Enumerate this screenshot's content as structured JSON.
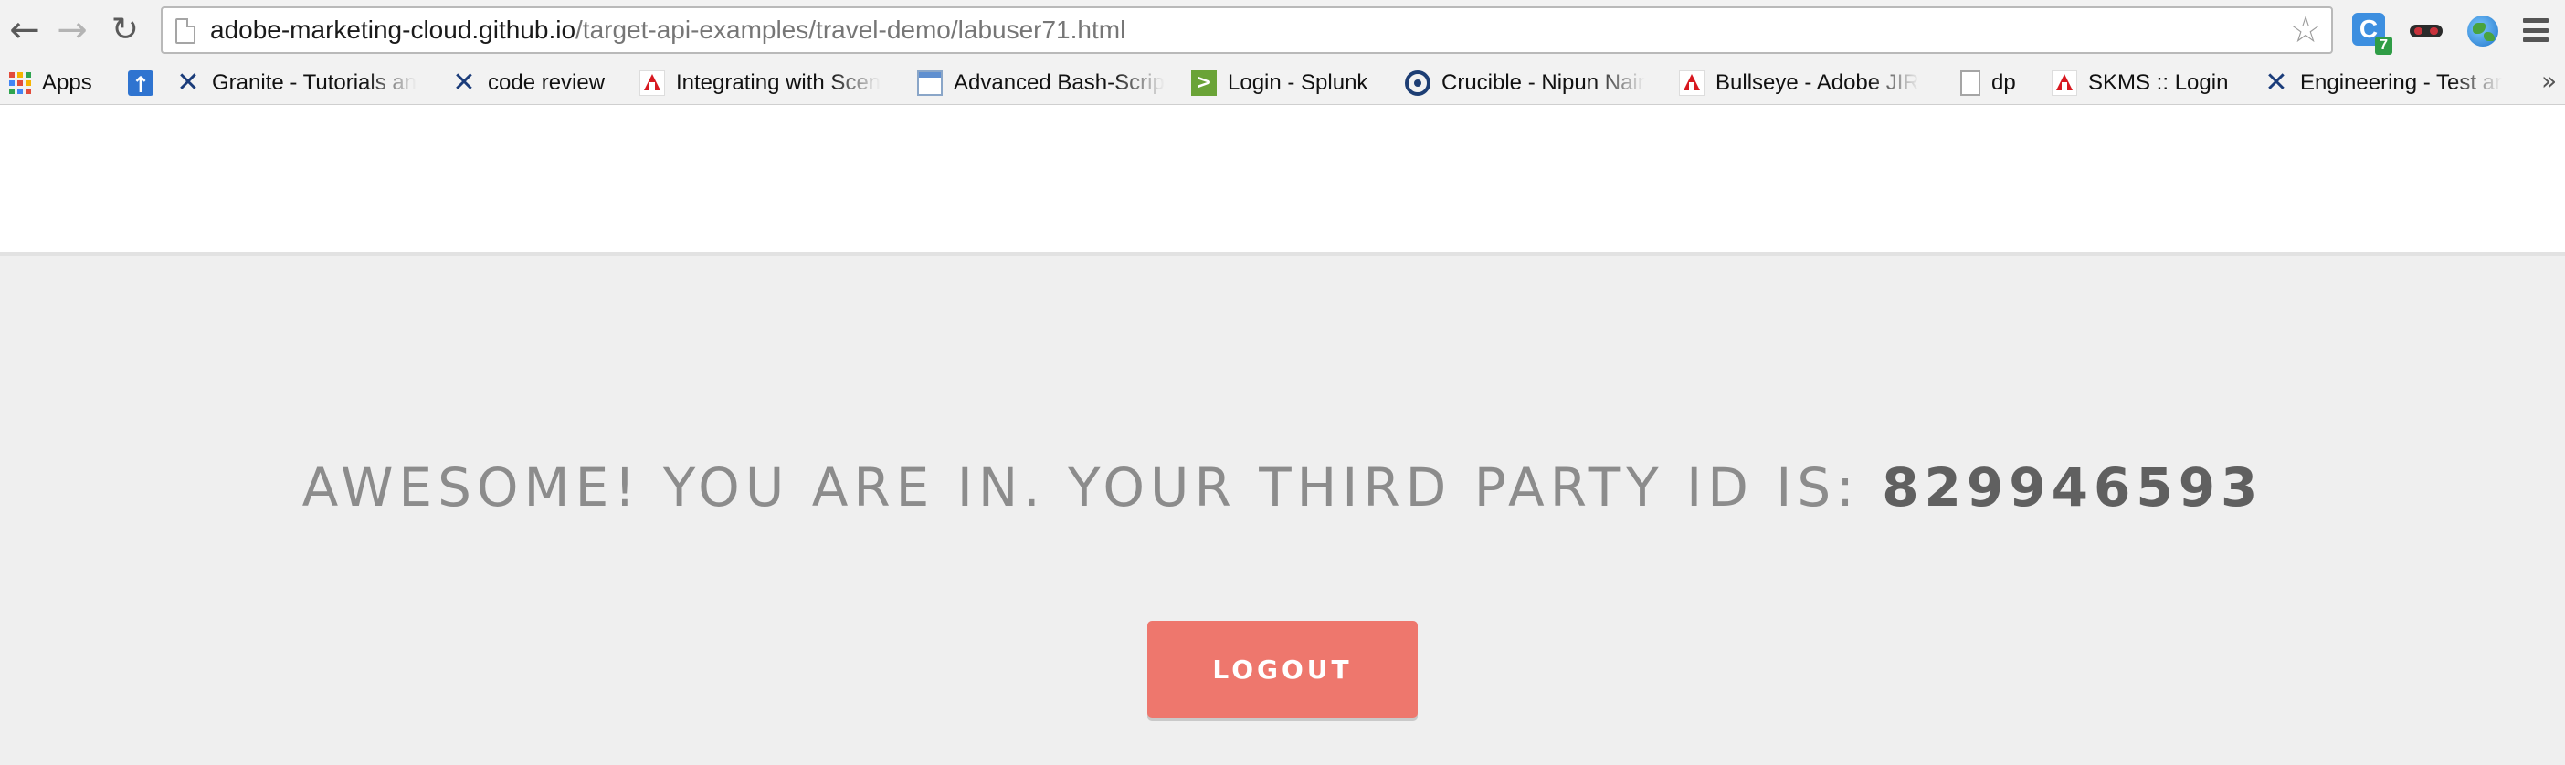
{
  "browser": {
    "url_host": "adobe-marketing-cloud.github.io",
    "url_path": "/target-api-examples/travel-demo/labuser71.html",
    "extensions": [
      {
        "name": "c-extension-icon",
        "badge": "7"
      },
      {
        "name": "mask-extension-icon"
      },
      {
        "name": "globe-extension-icon"
      }
    ]
  },
  "bookmarks": [
    {
      "label": "Apps",
      "icon": "apps-grid-icon"
    },
    {
      "label": "",
      "icon": "blue-upload-icon"
    },
    {
      "label": "Granite - Tutorials an",
      "icon": "x-logo-icon"
    },
    {
      "label": "code review",
      "icon": "x-logo-icon"
    },
    {
      "label": "Integrating with Scen",
      "icon": "adobe-icon"
    },
    {
      "label": "Advanced Bash-Scrip",
      "icon": "bash-page-icon"
    },
    {
      "label": "Login - Splunk",
      "icon": "splunk-icon"
    },
    {
      "label": "Crucible - Nipun Nair",
      "icon": "crucible-icon"
    },
    {
      "label": "Bullseye - Adobe JIR",
      "icon": "adobe-icon"
    },
    {
      "label": "dp",
      "icon": "document-icon"
    },
    {
      "label": "SKMS :: Login",
      "icon": "adobe-icon"
    },
    {
      "label": "Engineering - Test ar",
      "icon": "x-logo-icon"
    }
  ],
  "page": {
    "message": "AWESOME! YOU ARE IN. YOUR THIRD PARTY ID IS:",
    "third_party_id": "829946593",
    "logout_label": "LOGOUT",
    "accent_color": "#ee776d"
  }
}
